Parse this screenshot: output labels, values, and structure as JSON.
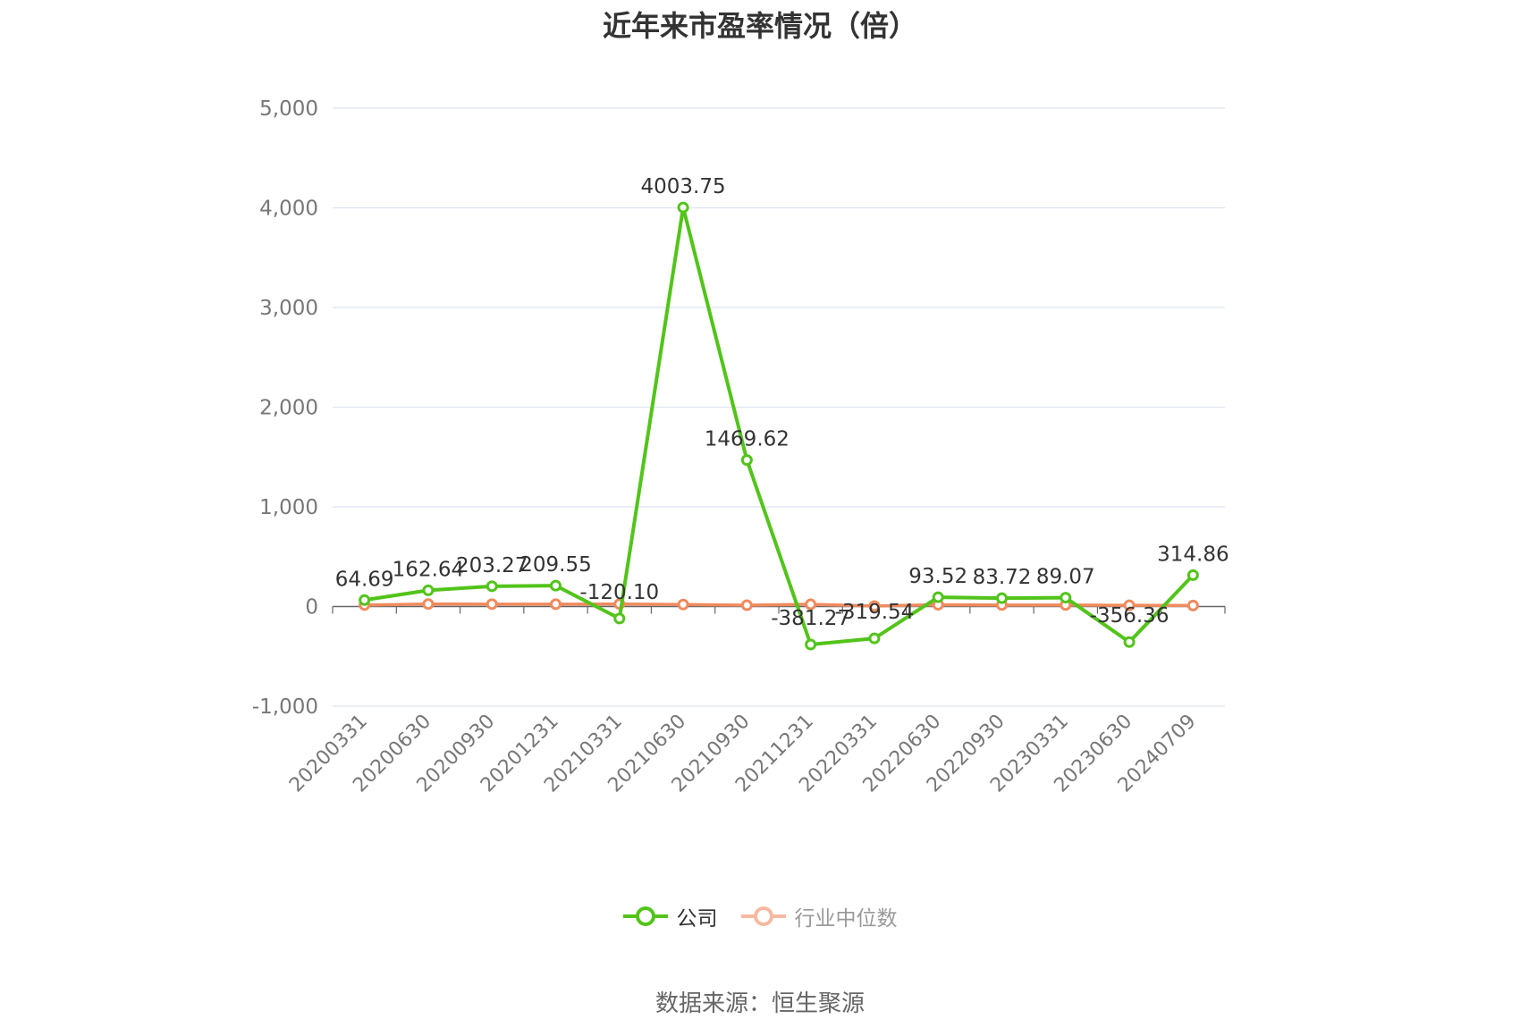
{
  "chart_data": {
    "type": "line",
    "title": "近年来市盈率情况（倍）",
    "categories": [
      "20200331",
      "20200630",
      "20200930",
      "20201231",
      "20210331",
      "20210630",
      "20210930",
      "20211231",
      "20220331",
      "20220630",
      "20220930",
      "20230331",
      "20230630",
      "20240709"
    ],
    "series": [
      {
        "name": "公司",
        "color": "#52c41a",
        "values": [
          64.69,
          162.64,
          203.27,
          209.55,
          -120.1,
          4003.75,
          1469.62,
          -381.27,
          -319.54,
          93.52,
          83.72,
          89.07,
          -356.36,
          314.86
        ],
        "labels": [
          "64.69",
          "162.64",
          "203.27",
          "209.55",
          "-120.10",
          "4003.75",
          "1469.62",
          "-381.27",
          "-319.54",
          "93.52",
          "83.72",
          "89.07",
          "-356.36",
          "314.86"
        ]
      },
      {
        "name": "行业中位数",
        "color": "#f08a5d",
        "values": [
          15,
          25,
          24,
          23,
          25,
          20,
          13,
          22,
          5,
          18,
          15,
          15,
          12,
          10
        ]
      }
    ],
    "yticks": [
      "-1,000",
      "0",
      "1,000",
      "2,000",
      "3,000",
      "4,000",
      "5,000"
    ],
    "ylim": [
      -1000,
      5000
    ],
    "grid": true,
    "legend_position": "bottom-center"
  },
  "legend": {
    "company": "公司",
    "industry": "行业中位数"
  },
  "source": "数据来源：恒生聚源"
}
